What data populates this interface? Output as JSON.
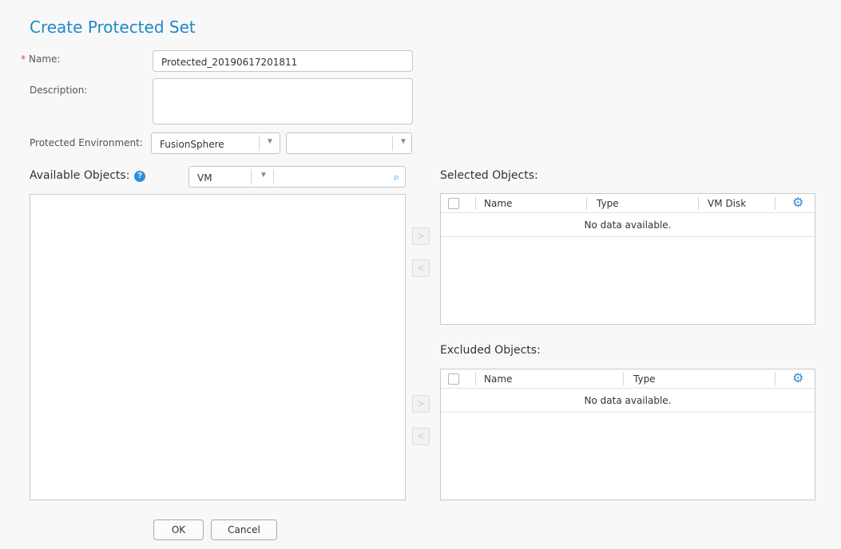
{
  "dialog": {
    "title": "Create Protected Set"
  },
  "form": {
    "name_required_mark": "*",
    "name_label": "Name:",
    "name_value": "Protected_20190617201811",
    "description_label": "Description:",
    "description_value": "",
    "environment_label": "Protected Environment:",
    "environment_value": "FusionSphere",
    "environment_secondary_value": ""
  },
  "available": {
    "label": "Available Objects:",
    "help_icon": "question-circle-icon",
    "type_value": "VM",
    "search_value": "",
    "search_icon": "search-icon"
  },
  "selected": {
    "label": "Selected Objects:",
    "columns": [
      "Name",
      "Type",
      "VM Disk"
    ],
    "empty_text": "No data available.",
    "settings_icon": "gear-icon"
  },
  "excluded": {
    "label": "Excluded Objects:",
    "columns": [
      "Name",
      "Type"
    ],
    "empty_text": "No data available.",
    "settings_icon": "gear-icon"
  },
  "transfer": {
    "add_glyph": ">",
    "remove_glyph": "<"
  },
  "footer": {
    "ok_label": "OK",
    "cancel_label": "Cancel"
  },
  "colors": {
    "title": "#2088c8",
    "accent": "#2e8ede",
    "required": "#e0463e"
  }
}
